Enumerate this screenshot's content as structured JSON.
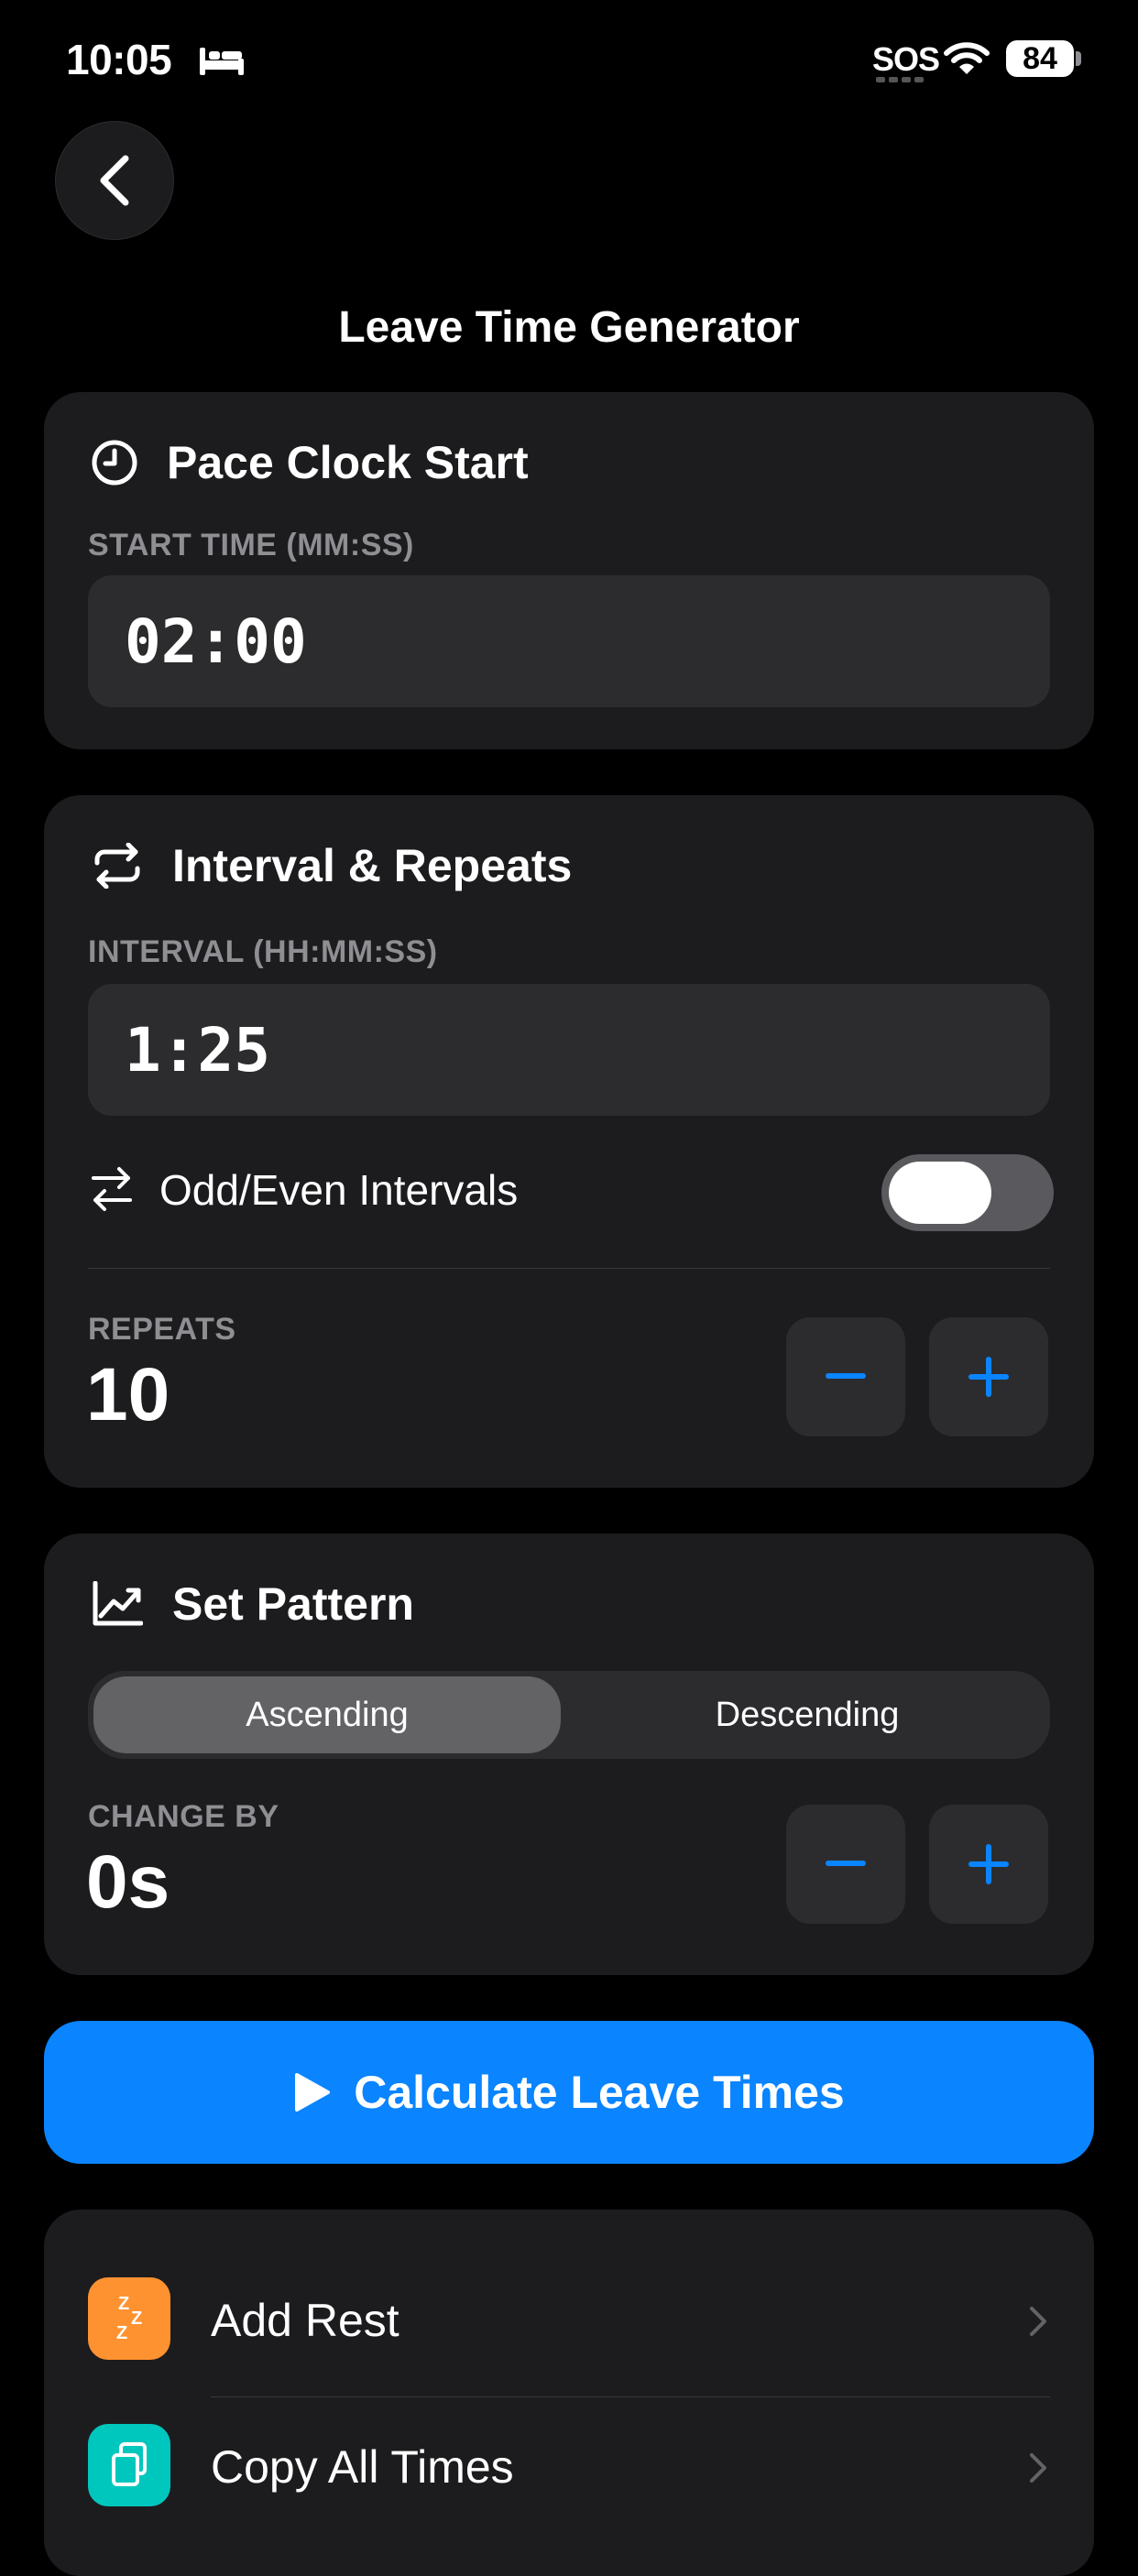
{
  "status_bar": {
    "time": "10:05",
    "sos": "SOS",
    "battery": "84",
    "icons": [
      "bed-icon",
      "wifi-icon",
      "battery-icon"
    ]
  },
  "nav": {
    "back_icon": "chevron-left-icon",
    "title": "Leave Time Generator"
  },
  "pace_clock": {
    "title": "Pace Clock Start",
    "icon": "clock-icon",
    "caption": "START TIME (MM:SS)",
    "value": "02:00"
  },
  "interval": {
    "title": "Interval & Repeats",
    "icon": "repeat-icon",
    "caption": "INTERVAL (HH:MM:SS)",
    "value": "1:25",
    "odd_even_label": "Odd/Even Intervals",
    "odd_even_icon": "arrows-left-right-icon",
    "odd_even_on": false,
    "repeats_caption": "REPEATS",
    "repeats_value": "10"
  },
  "set_pattern": {
    "title": "Set Pattern",
    "icon": "chart-line-icon",
    "options": [
      "Ascending",
      "Descending"
    ],
    "selected": "Ascending",
    "change_caption": "CHANGE BY",
    "change_value": "0s"
  },
  "cta": {
    "label": "Calculate Leave Times",
    "icon": "play-icon"
  },
  "list": [
    {
      "label": "Add Rest",
      "icon": "zzz-icon",
      "color": "#ff9230"
    },
    {
      "label": "Copy All Times",
      "icon": "copy-icon",
      "color": "#00c7be"
    }
  ],
  "colors": {
    "accent": "#0a84ff",
    "card": "#1c1c1e",
    "field": "#2c2c2e"
  }
}
